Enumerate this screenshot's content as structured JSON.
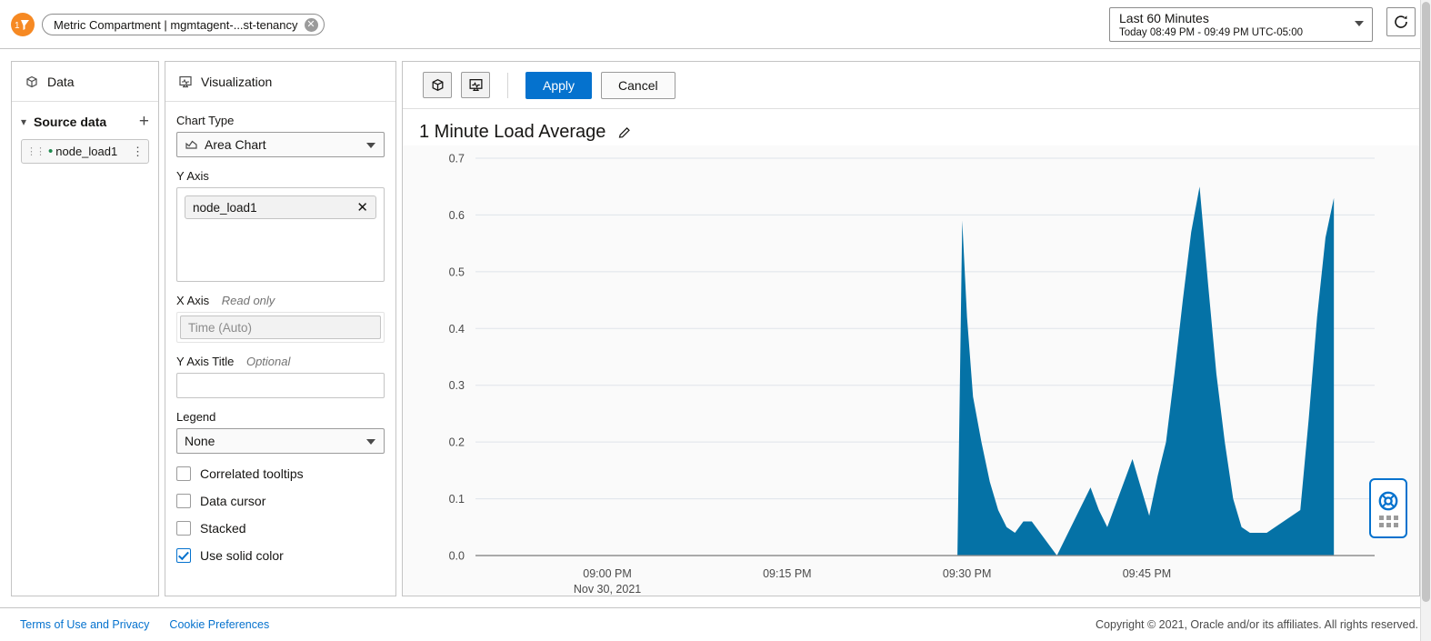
{
  "topbar": {
    "logo_icon": "oracle-logo-icon",
    "chip_label": "Metric Compartment | mgmtagent-...st-tenancy",
    "chip_close_icon": "chip-close-icon",
    "time_range_main": "Last 60 Minutes",
    "time_range_sub": "Today 08:49 PM - 09:49 PM UTC-05:00",
    "time_range_arrow_icon": "chevron-down-icon",
    "refresh_icon": "refresh-icon"
  },
  "data_panel": {
    "header": "Data",
    "header_icon": "cube-icon",
    "source_data_label": "Source data",
    "caret_icon": "chevron-down-icon",
    "add_icon": "plus-icon",
    "items": [
      {
        "label": "node_load1",
        "grip_icon": "drag-grip-icon",
        "status_icon": "green-dot-icon",
        "menu_icon": "kebab-menu-icon"
      }
    ]
  },
  "viz_panel": {
    "header": "Visualization",
    "header_icon": "monitor-chart-icon",
    "chart_type_label": "Chart Type",
    "chart_type_value": "Area Chart",
    "chart_type_icon": "area-chart-icon",
    "y_axis_label": "Y Axis",
    "y_axis_tokens": [
      "node_load1"
    ],
    "y_axis_token_remove_icon": "close-icon",
    "x_axis_label": "X Axis",
    "x_axis_note": "Read only",
    "x_axis_value": "Time (Auto)",
    "y_axis_title_label": "Y Axis Title",
    "y_axis_title_note": "Optional",
    "y_axis_title_value": "",
    "legend_label": "Legend",
    "legend_value": "None",
    "checkboxes": [
      {
        "label": "Correlated tooltips",
        "checked": false
      },
      {
        "label": "Data cursor",
        "checked": false
      },
      {
        "label": "Stacked",
        "checked": false
      },
      {
        "label": "Use solid color",
        "checked": true
      }
    ]
  },
  "chart_panel": {
    "toolbar": {
      "data_tool_icon": "cube-icon",
      "viz_tool_icon": "monitor-chart-icon",
      "apply_label": "Apply",
      "cancel_label": "Cancel"
    },
    "title": "1 Minute Load Average",
    "edit_icon": "pencil-icon"
  },
  "help_widget": {
    "icon": "lifesaver-help-icon",
    "grip_icon": "drag-dots-icon"
  },
  "footer": {
    "terms_link": "Terms of Use and Privacy",
    "cookie_link": "Cookie Preferences",
    "copyright": "Copyright © 2021, Oracle and/or its affiliates. All rights reserved."
  },
  "colors": {
    "accent_blue": "#0572ce",
    "series_blue": "#0572a6",
    "brand_orange": "#f68923",
    "green_status": "#1d8a4d"
  },
  "chart_data": {
    "type": "area",
    "title": "1 Minute Load Average",
    "xlabel": "",
    "ylabel": "",
    "grid": true,
    "legend": "none",
    "stacked": false,
    "solid_color": true,
    "series_color": "#0572a6",
    "ylim": [
      0.0,
      0.7
    ],
    "ytick_labels": [
      "0.0",
      "0.1",
      "0.2",
      "0.3",
      "0.4",
      "0.5",
      "0.6",
      "0.7"
    ],
    "ytick_values": [
      0.0,
      0.1,
      0.2,
      0.3,
      0.4,
      0.5,
      0.6,
      0.7
    ],
    "xtick_labels": [
      "09:00 PM",
      "09:15 PM",
      "09:30 PM",
      "09:45 PM"
    ],
    "xtick_sublabels": [
      "Nov 30, 2021",
      "",
      "",
      ""
    ],
    "xtick_minutes": [
      0,
      15,
      30,
      45
    ],
    "xlim_minutes": [
      -11,
      64
    ],
    "series": [
      {
        "name": "node_load1",
        "x_minutes": [
          29.2,
          29.6,
          30.0,
          30.5,
          31.2,
          31.9,
          32.6,
          33.3,
          34.0,
          34.7,
          35.4,
          36.1,
          36.8,
          37.5,
          38.2,
          38.9,
          39.6,
          40.3,
          41.0,
          41.7,
          42.4,
          43.1,
          43.8,
          44.5,
          45.2,
          45.9,
          46.6,
          47.3,
          48.0,
          48.7,
          49.4,
          50.1,
          50.8,
          51.5,
          52.2,
          52.9,
          53.6,
          54.3,
          55.0,
          55.7,
          56.4,
          57.1,
          57.8,
          58.5,
          59.2,
          59.9,
          60.6
        ],
        "values": [
          0.0,
          0.59,
          0.42,
          0.28,
          0.2,
          0.13,
          0.08,
          0.05,
          0.04,
          0.06,
          0.06,
          0.04,
          0.02,
          0.0,
          0.03,
          0.06,
          0.09,
          0.12,
          0.08,
          0.05,
          0.09,
          0.13,
          0.17,
          0.12,
          0.07,
          0.14,
          0.2,
          0.32,
          0.45,
          0.57,
          0.65,
          0.48,
          0.32,
          0.2,
          0.1,
          0.05,
          0.04,
          0.04,
          0.04,
          0.05,
          0.06,
          0.07,
          0.08,
          0.24,
          0.42,
          0.56,
          0.63
        ]
      }
    ]
  }
}
